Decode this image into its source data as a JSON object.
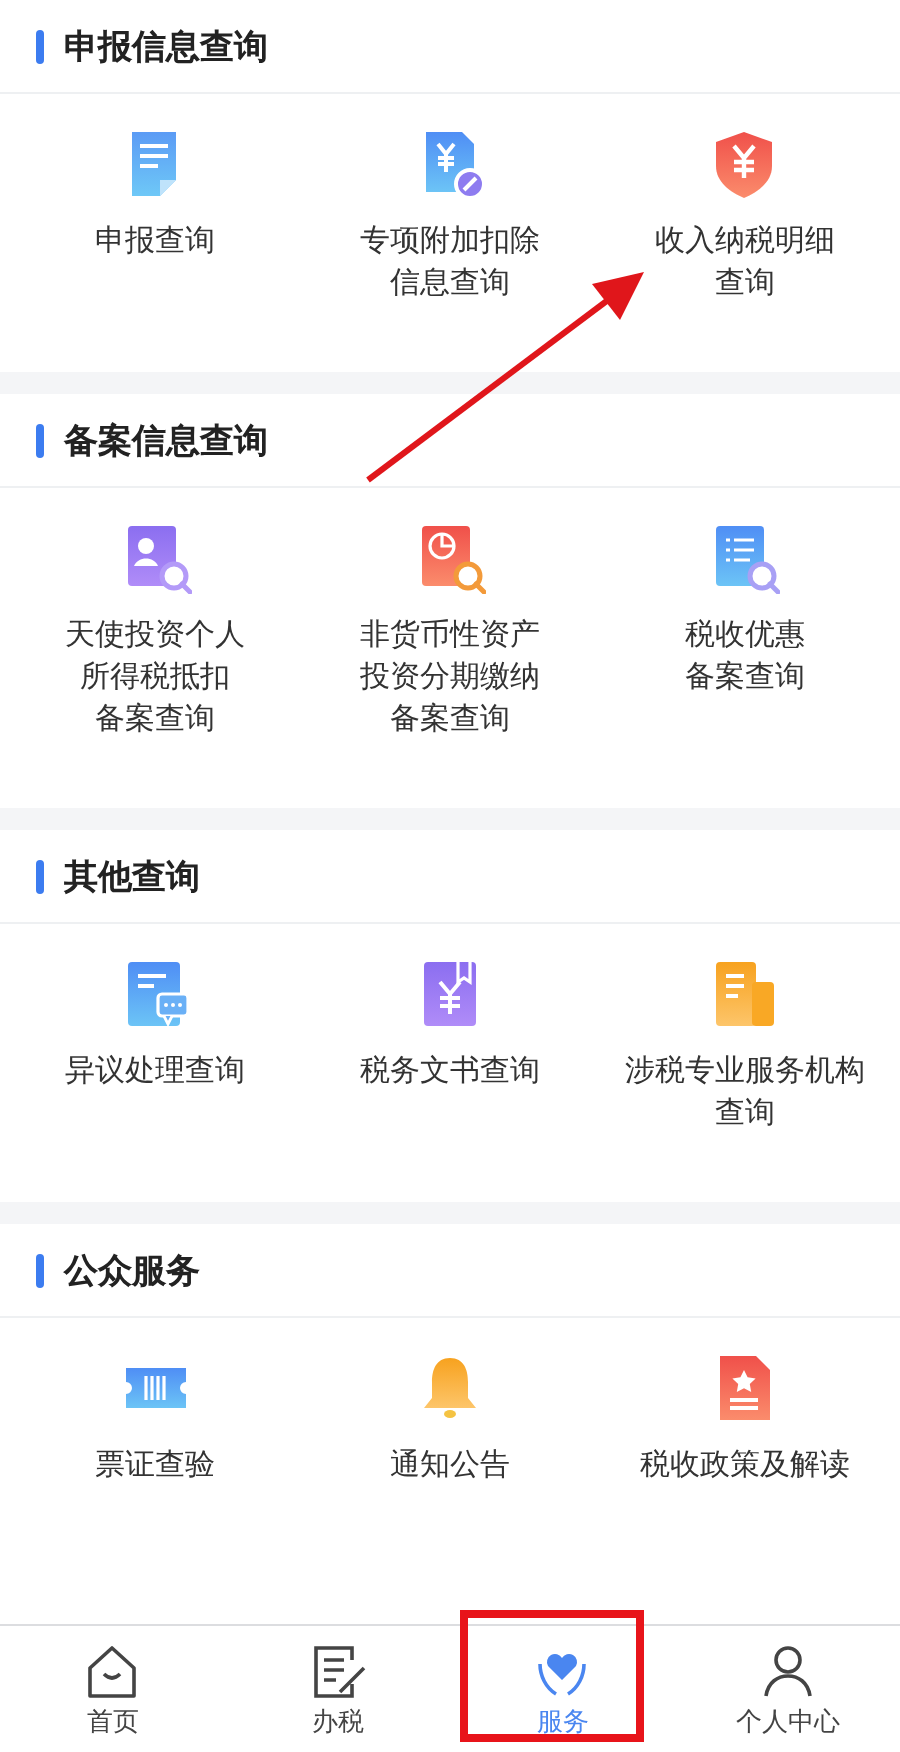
{
  "sections": [
    {
      "title": "申报信息查询",
      "items": [
        {
          "label": [
            "申报查询"
          ]
        },
        {
          "label": [
            "专项附加扣除",
            "信息查询"
          ]
        },
        {
          "label": [
            "收入纳税明细",
            "查询"
          ]
        }
      ]
    },
    {
      "title": "备案信息查询",
      "items": [
        {
          "label": [
            "天使投资个人",
            "所得税抵扣",
            "备案查询"
          ]
        },
        {
          "label": [
            "非货币性资产",
            "投资分期缴纳",
            "备案查询"
          ]
        },
        {
          "label": [
            "税收优惠",
            "备案查询"
          ]
        }
      ]
    },
    {
      "title": "其他查询",
      "items": [
        {
          "label": [
            "异议处理查询"
          ]
        },
        {
          "label": [
            "税务文书查询"
          ]
        },
        {
          "label": [
            "涉税专业服务机构",
            "查询"
          ]
        }
      ]
    },
    {
      "title": "公众服务",
      "items": [
        {
          "label": [
            "票证查验"
          ]
        },
        {
          "label": [
            "通知公告"
          ]
        },
        {
          "label": [
            "税收政策及解读"
          ]
        }
      ]
    }
  ],
  "nav": [
    {
      "label": "首页",
      "selected": false,
      "highlighted": false
    },
    {
      "label": "办税",
      "selected": false,
      "highlighted": false
    },
    {
      "label": "服务",
      "selected": true,
      "highlighted": true
    },
    {
      "label": "个人中心",
      "selected": false,
      "highlighted": false
    }
  ],
  "pointer_arrow": true
}
